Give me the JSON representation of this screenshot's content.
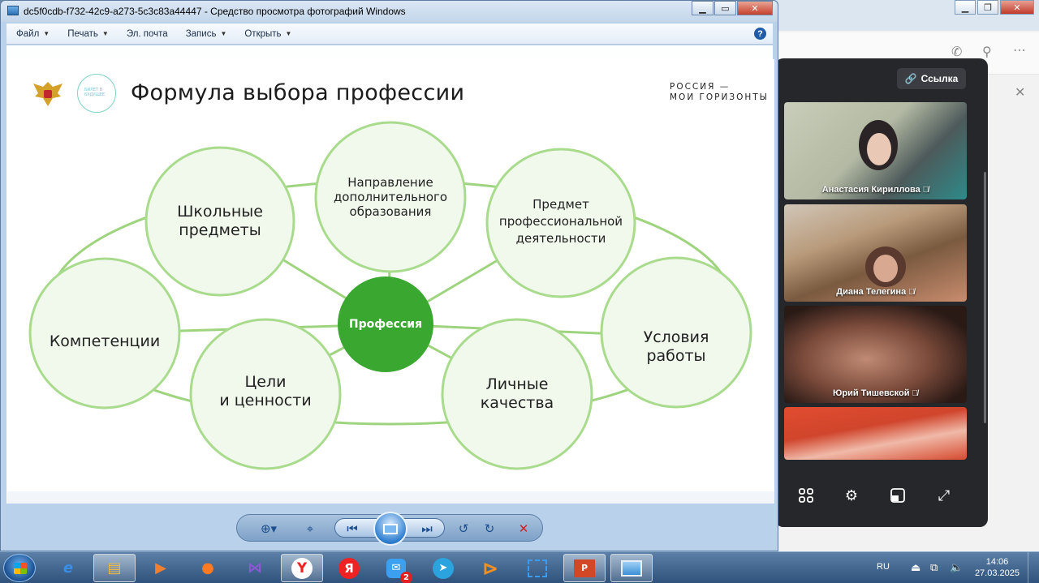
{
  "viewer": {
    "title": "dc5f0cdb-f732-42c9-a273-5c3c83a44447 - Средство просмотра фотографий Windows",
    "menu": [
      {
        "label": "Файл",
        "has_caret": true
      },
      {
        "label": "Печать",
        "has_caret": true
      },
      {
        "label": "Эл. почта",
        "has_caret": false
      },
      {
        "label": "Запись",
        "has_caret": true
      },
      {
        "label": "Открыть",
        "has_caret": true
      }
    ],
    "help_icon": "?"
  },
  "slide": {
    "title": "Формула выбора профессии",
    "brand_line1": "РОССИЯ —",
    "brand_line2": "МОИ ГОРИЗОНТЫ",
    "logo_text": "БИЛЕТ В БУДУЩЕЕ",
    "center": "Профессия",
    "nodes": {
      "school": [
        "Школьные",
        "предметы"
      ],
      "education": [
        "Направление",
        "дополнительного",
        "образования"
      ],
      "subject": [
        "Предмет",
        "профессиональной",
        "деятельности"
      ],
      "competence": [
        "Компетенции"
      ],
      "goals": [
        "Цели",
        "и ценности"
      ],
      "qualities": [
        "Личные",
        "качества"
      ],
      "conditions": [
        "Условия",
        "работы"
      ]
    },
    "colors": {
      "accent": "#3aa830",
      "circle_fill": "#f1f8ec",
      "circle_stroke": "#a9db8d",
      "line": "#9fd47f"
    }
  },
  "call": {
    "link_label": "Ссылка",
    "participants": [
      {
        "name": "Анастасия Кириллова",
        "muted": true
      },
      {
        "name": "Диана Телегина",
        "muted": true
      },
      {
        "name": "Юрий Тишевской",
        "muted": true
      },
      {
        "name": "",
        "muted": false
      }
    ],
    "controls": [
      "grid-icon",
      "gear-icon",
      "pip-icon",
      "fullscreen-icon"
    ]
  },
  "taskbar": {
    "apps": [
      "ie-icon",
      "explorer-icon",
      "media-player-icon",
      "firefox-icon",
      "visual-studio-icon",
      "yandex-browser-icon",
      "yandex-icon",
      "messenger-icon",
      "telegram-icon",
      "player-icon",
      "snipping-icon",
      "presentation-icon",
      "photo-viewer-icon"
    ],
    "badge": "2",
    "lang": "RU",
    "time": "14:06",
    "date": "27.03.2025"
  }
}
